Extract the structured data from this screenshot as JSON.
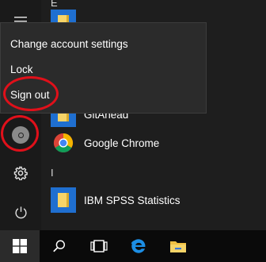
{
  "account_menu": {
    "items": [
      "Change account settings",
      "Lock",
      "Sign out"
    ]
  },
  "app_list": {
    "letters": [
      "E",
      "I"
    ],
    "apps": [
      "GitAhead",
      "Google Chrome",
      "IBM SPSS Statistics"
    ]
  },
  "annotation_color": "#e0101a",
  "accent_colors": {
    "tile": "#1f6fd0",
    "edge": "#1c8ee5",
    "folder": "#f0c043"
  },
  "icons": [
    "user-avatar",
    "settings-gear",
    "power",
    "windows-logo",
    "search",
    "task-view",
    "edge",
    "file-explorer",
    "chrome"
  ]
}
